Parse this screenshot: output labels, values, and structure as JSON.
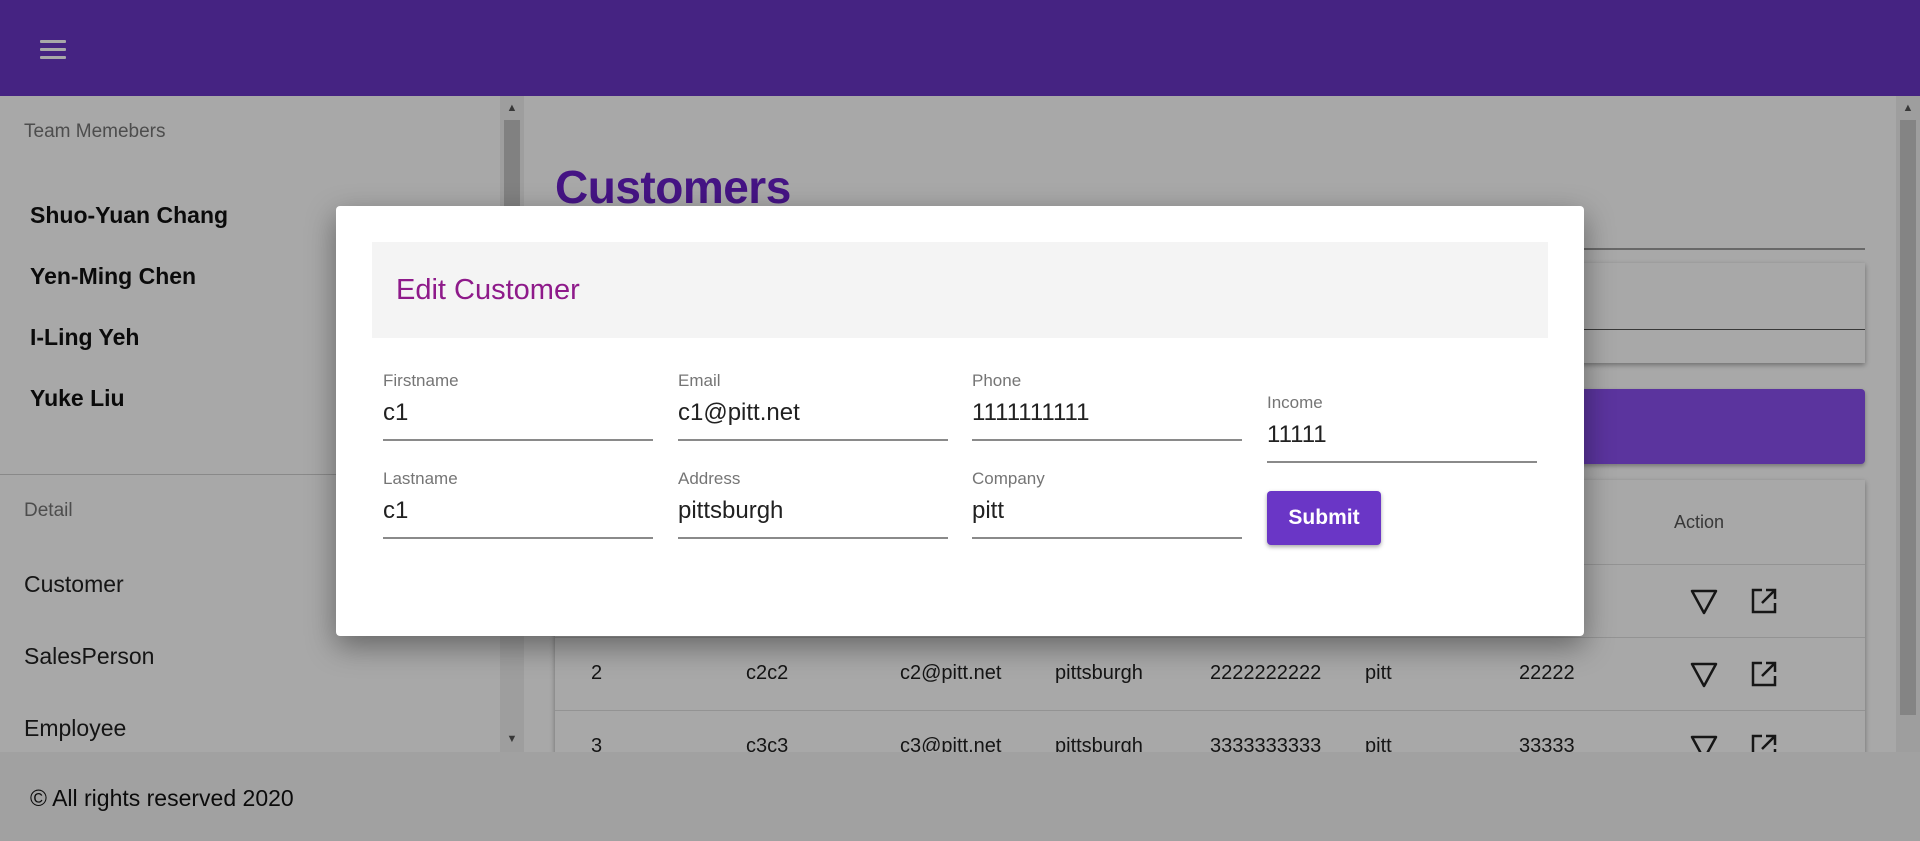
{
  "sidebar": {
    "team_header": "Team Memebers",
    "members": [
      "Shuo-Yuan Chang",
      "Yen-Ming Chen",
      "I-Ling Yeh",
      "Yuke Liu"
    ],
    "detail_header": "Detail",
    "detail_items": [
      "Customer",
      "SalesPerson",
      "Employee"
    ]
  },
  "main": {
    "title": "Customers",
    "table": {
      "action_header": "Action",
      "rows": [
        {
          "id": "2",
          "name": "c2c2",
          "email": "c2@pitt.net",
          "address": "pittsburgh",
          "phone": "2222222222",
          "company": "pitt",
          "income": "22222"
        },
        {
          "id": "3",
          "name": "c3c3",
          "email": "c3@pitt.net",
          "address": "pittsburgh",
          "phone": "3333333333",
          "company": "pitt",
          "income": "33333"
        }
      ]
    }
  },
  "footer": {
    "text": "© All rights reserved 2020"
  },
  "modal": {
    "title": "Edit Customer",
    "fields": {
      "firstname": {
        "label": "Firstname",
        "value": "c1"
      },
      "lastname": {
        "label": "Lastname",
        "value": "c1"
      },
      "email": {
        "label": "Email",
        "value": "c1@pitt.net"
      },
      "address": {
        "label": "Address",
        "value": "pittsburgh"
      },
      "phone": {
        "label": "Phone",
        "value": "1111111111"
      },
      "company": {
        "label": "Company",
        "value": "pitt"
      },
      "income": {
        "label": "Income",
        "value": "11111"
      }
    },
    "submit_label": "Submit"
  },
  "colors": {
    "appbar": "#6a36c6",
    "title": "#6a1fc9",
    "modal_title": "#8e1a8a"
  }
}
